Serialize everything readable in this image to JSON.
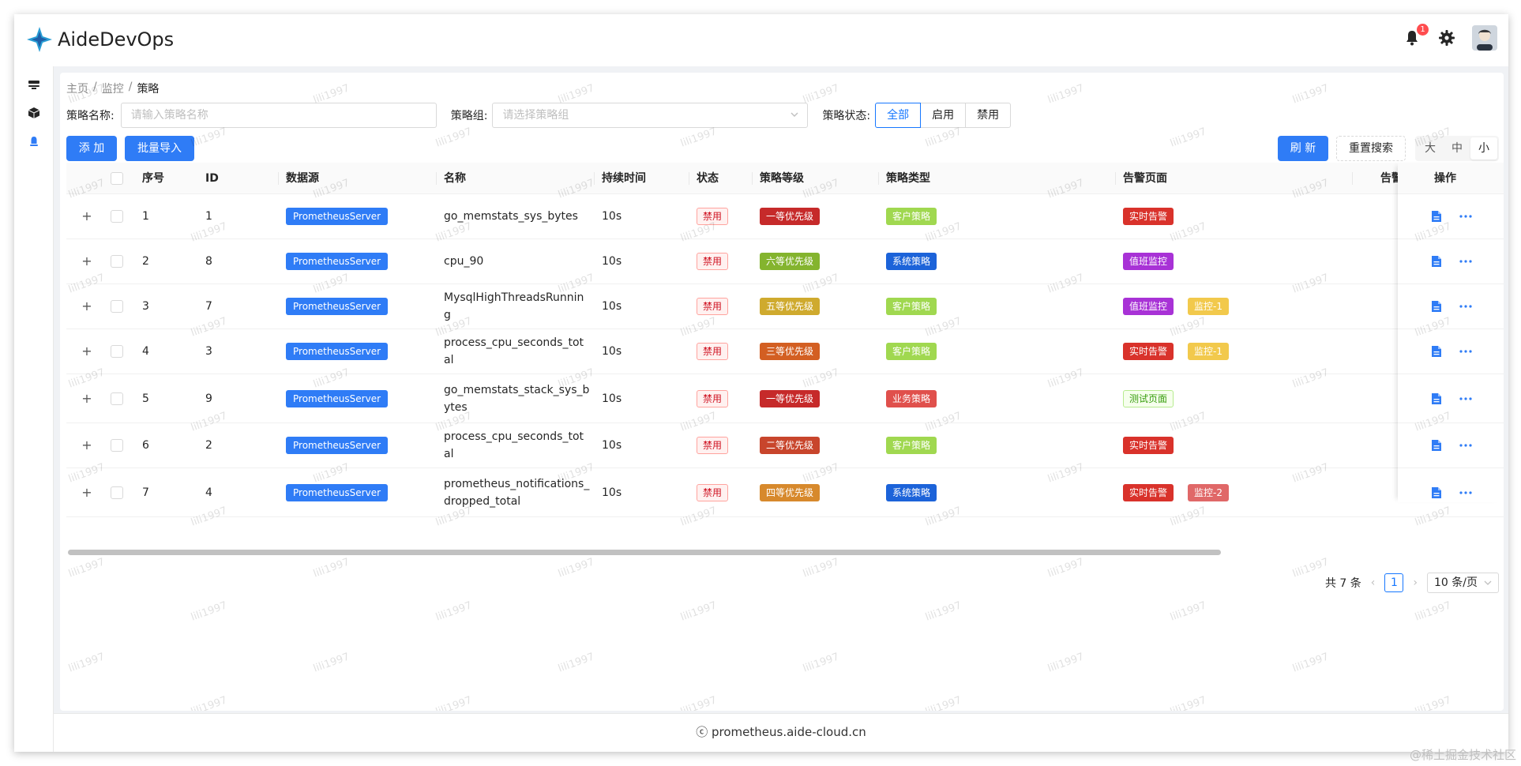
{
  "app": {
    "title": "AideDevOps",
    "notification_count": "1"
  },
  "breadcrumb": [
    "主页",
    "监控",
    "策略"
  ],
  "filters": {
    "name_label": "策略名称:",
    "name_placeholder": "请输入策略名称",
    "group_label": "策略组:",
    "group_placeholder": "请选择策略组",
    "status_label": "策略状态:",
    "status_options": [
      "全部",
      "启用",
      "禁用"
    ],
    "status_selected": "全部"
  },
  "toolbar": {
    "add": "添 加",
    "batch_import": "批量导入",
    "refresh": "刷 新",
    "reset": "重置搜索",
    "sizes": [
      "大",
      "中",
      "小"
    ],
    "size_selected": "小"
  },
  "table": {
    "headers": {
      "index": "序号",
      "id": "ID",
      "datasource": "数据源",
      "name": "名称",
      "duration": "持续时间",
      "status": "状态",
      "level": "策略等级",
      "type": "策略类型",
      "alarm_page": "告警页面",
      "alarm": "告警",
      "actions": "操作"
    },
    "rows": [
      {
        "index": "1",
        "id": "1",
        "datasource": "PrometheusServer",
        "name": "go_memstats_sys_bytes",
        "duration": "10s",
        "status": "禁用",
        "level": "一等优先级",
        "level_color": "#c62a2a",
        "type": "客户策略",
        "type_color": "#a0d850",
        "pages": [
          {
            "label": "实时告警",
            "color": "#d9322b"
          }
        ]
      },
      {
        "index": "2",
        "id": "8",
        "datasource": "PrometheusServer",
        "name": "cpu_90",
        "duration": "10s",
        "status": "禁用",
        "level": "六等优先级",
        "level_color": "#84b42e",
        "type": "系统策略",
        "type_color": "#1c63d9",
        "pages": [
          {
            "label": "值班监控",
            "color": "#a832d6"
          }
        ]
      },
      {
        "index": "3",
        "id": "7",
        "datasource": "PrometheusServer",
        "name": "MysqlHighThreadsRunning",
        "duration": "10s",
        "status": "禁用",
        "level": "五等优先级",
        "level_color": "#cfaa2e",
        "type": "客户策略",
        "type_color": "#a0d850",
        "pages": [
          {
            "label": "值班监控",
            "color": "#a832d6"
          },
          {
            "label": "监控-1",
            "color": "#f2c94c"
          }
        ]
      },
      {
        "index": "4",
        "id": "3",
        "datasource": "PrometheusServer",
        "name": "process_cpu_seconds_total",
        "duration": "10s",
        "status": "禁用",
        "level": "三等优先级",
        "level_color": "#d35f22",
        "type": "客户策略",
        "type_color": "#a0d850",
        "pages": [
          {
            "label": "实时告警",
            "color": "#d9322b"
          },
          {
            "label": "监控-1",
            "color": "#f2c94c"
          }
        ]
      },
      {
        "index": "5",
        "id": "9",
        "datasource": "PrometheusServer",
        "name": "go_memstats_stack_sys_bytes",
        "duration": "10s",
        "status": "禁用",
        "level": "一等优先级",
        "level_color": "#c62a2a",
        "type": "业务策略",
        "type_color": "#e0504c",
        "pages": [
          {
            "label": "测试页面",
            "color": "ok"
          }
        ]
      },
      {
        "index": "6",
        "id": "2",
        "datasource": "PrometheusServer",
        "name": "process_cpu_seconds_total",
        "duration": "10s",
        "status": "禁用",
        "level": "二等优先级",
        "level_color": "#c8452c",
        "type": "客户策略",
        "type_color": "#a0d850",
        "pages": [
          {
            "label": "实时告警",
            "color": "#d9322b"
          }
        ]
      },
      {
        "index": "7",
        "id": "4",
        "datasource": "PrometheusServer",
        "name": "prometheus_notifications_dropped_total",
        "duration": "10s",
        "status": "禁用",
        "level": "四等优先级",
        "level_color": "#d7892c",
        "type": "系统策略",
        "type_color": "#1c63d9",
        "pages": [
          {
            "label": "实时告警",
            "color": "#d9322b"
          },
          {
            "label": "监控-2",
            "color": "#e06868"
          }
        ]
      }
    ]
  },
  "pagination": {
    "total": "共 7 条",
    "current": "1",
    "page_size": "10 条/页"
  },
  "footer": {
    "text": "ⓒ prometheus.aide-cloud.cn"
  },
  "watermark": "lili1997",
  "corner_text": "@稀土掘金技术社区",
  "colors": {
    "primary": "#2f7cf6",
    "datasource_tag": "#2f7cf6"
  }
}
